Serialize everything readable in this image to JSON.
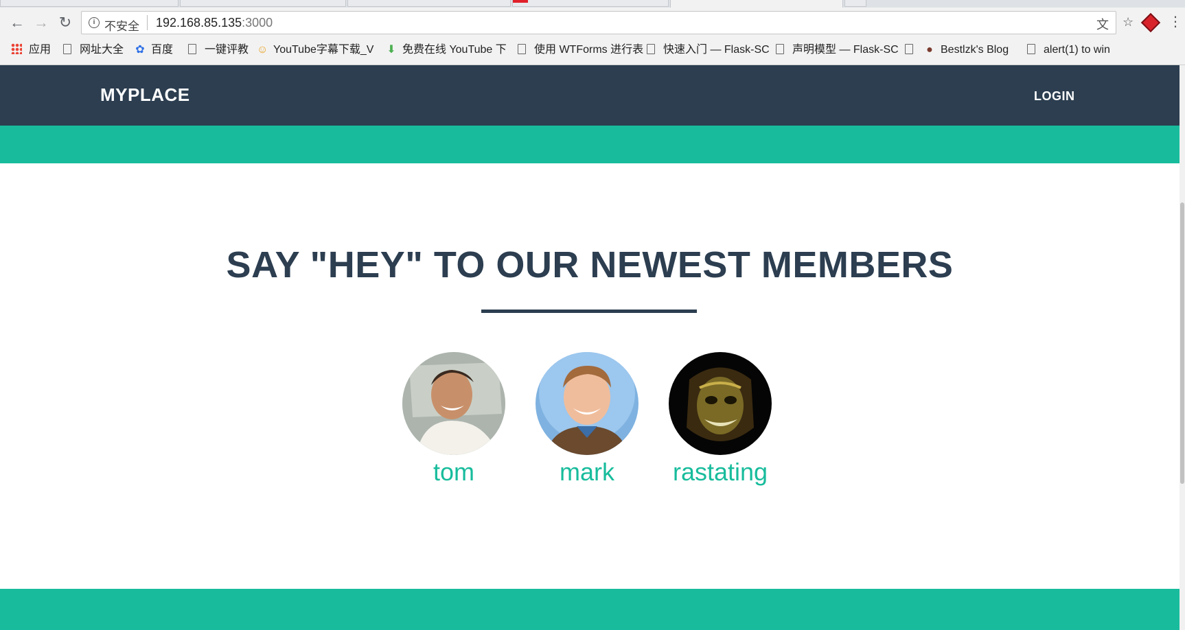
{
  "browser": {
    "security_label": "不安全",
    "url_host": "192.168.85.135",
    "url_port": ":3000",
    "bookmarks": [
      {
        "label": "应用",
        "icon": "apps-grid-icon"
      },
      {
        "label": "网址大全",
        "icon": "page-icon"
      },
      {
        "label": "百度",
        "icon": "baidu-paw-icon"
      },
      {
        "label": "一键评教",
        "icon": "page-icon"
      },
      {
        "label": "YouTube字幕下载_V",
        "icon": "smiley-icon"
      },
      {
        "label": "免费在线 YouTube 下",
        "icon": "download-arrow-icon"
      },
      {
        "label": "使用 WTForms 进行表",
        "icon": "page-icon"
      },
      {
        "label": "快速入门 — Flask-SC",
        "icon": "page-icon"
      },
      {
        "label": "声明模型 — Flask-SC",
        "icon": "page-icon"
      },
      {
        "label": "",
        "icon": "page-icon"
      },
      {
        "label": "Bestlzk's Blog",
        "icon": "avatar-icon"
      },
      {
        "label": "alert(1) to win",
        "icon": "page-icon"
      }
    ]
  },
  "site": {
    "brand": "MYPLACE",
    "login_label": "LOGIN",
    "heading": "SAY \"HEY\" TO OUR NEWEST MEMBERS",
    "members": [
      {
        "name": "tom"
      },
      {
        "name": "mark"
      },
      {
        "name": "rastating"
      }
    ],
    "colors": {
      "navbar": "#2c3e50",
      "accent": "#18bc9c",
      "heading": "#2c3e50"
    }
  }
}
